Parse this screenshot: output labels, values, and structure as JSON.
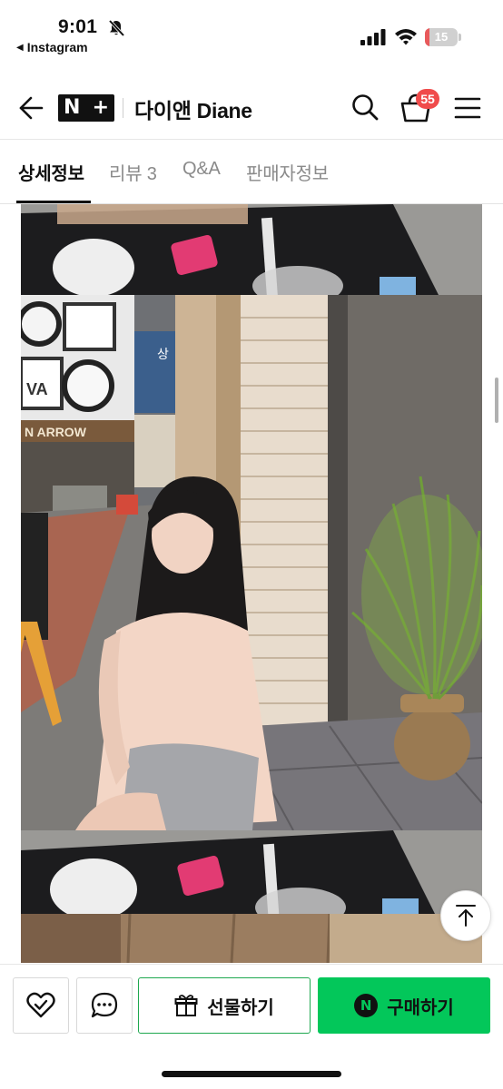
{
  "status_bar": {
    "time": "9:01",
    "back_app": "Instagram",
    "battery_level": "15",
    "battery_fraction": 0.15,
    "icons": [
      "bell-slash-icon",
      "signal-icon",
      "wifi-icon",
      "battery-icon"
    ]
  },
  "header": {
    "logo_text": "N+",
    "store_name": "다이앤 Diane",
    "cart_count": "55",
    "icons": [
      "back-arrow-icon",
      "search-icon",
      "cart-icon",
      "menu-icon"
    ]
  },
  "tabs": [
    {
      "label": "상세정보",
      "active": true
    },
    {
      "label": "리뷰 3",
      "active": false
    },
    {
      "label": "Q&A",
      "active": false
    },
    {
      "label": "판매자정보",
      "active": false
    }
  ],
  "product_image": {
    "signs": [
      "상",
      "N ARROW",
      "VA"
    ]
  },
  "bottom_bar": {
    "gift_label": "선물하기",
    "buy_label": "구매하기",
    "buy_badge": "N"
  },
  "colors": {
    "accent_green": "#03c75a",
    "gift_border": "#1ea84f",
    "badge_red": "#f04b4b"
  }
}
